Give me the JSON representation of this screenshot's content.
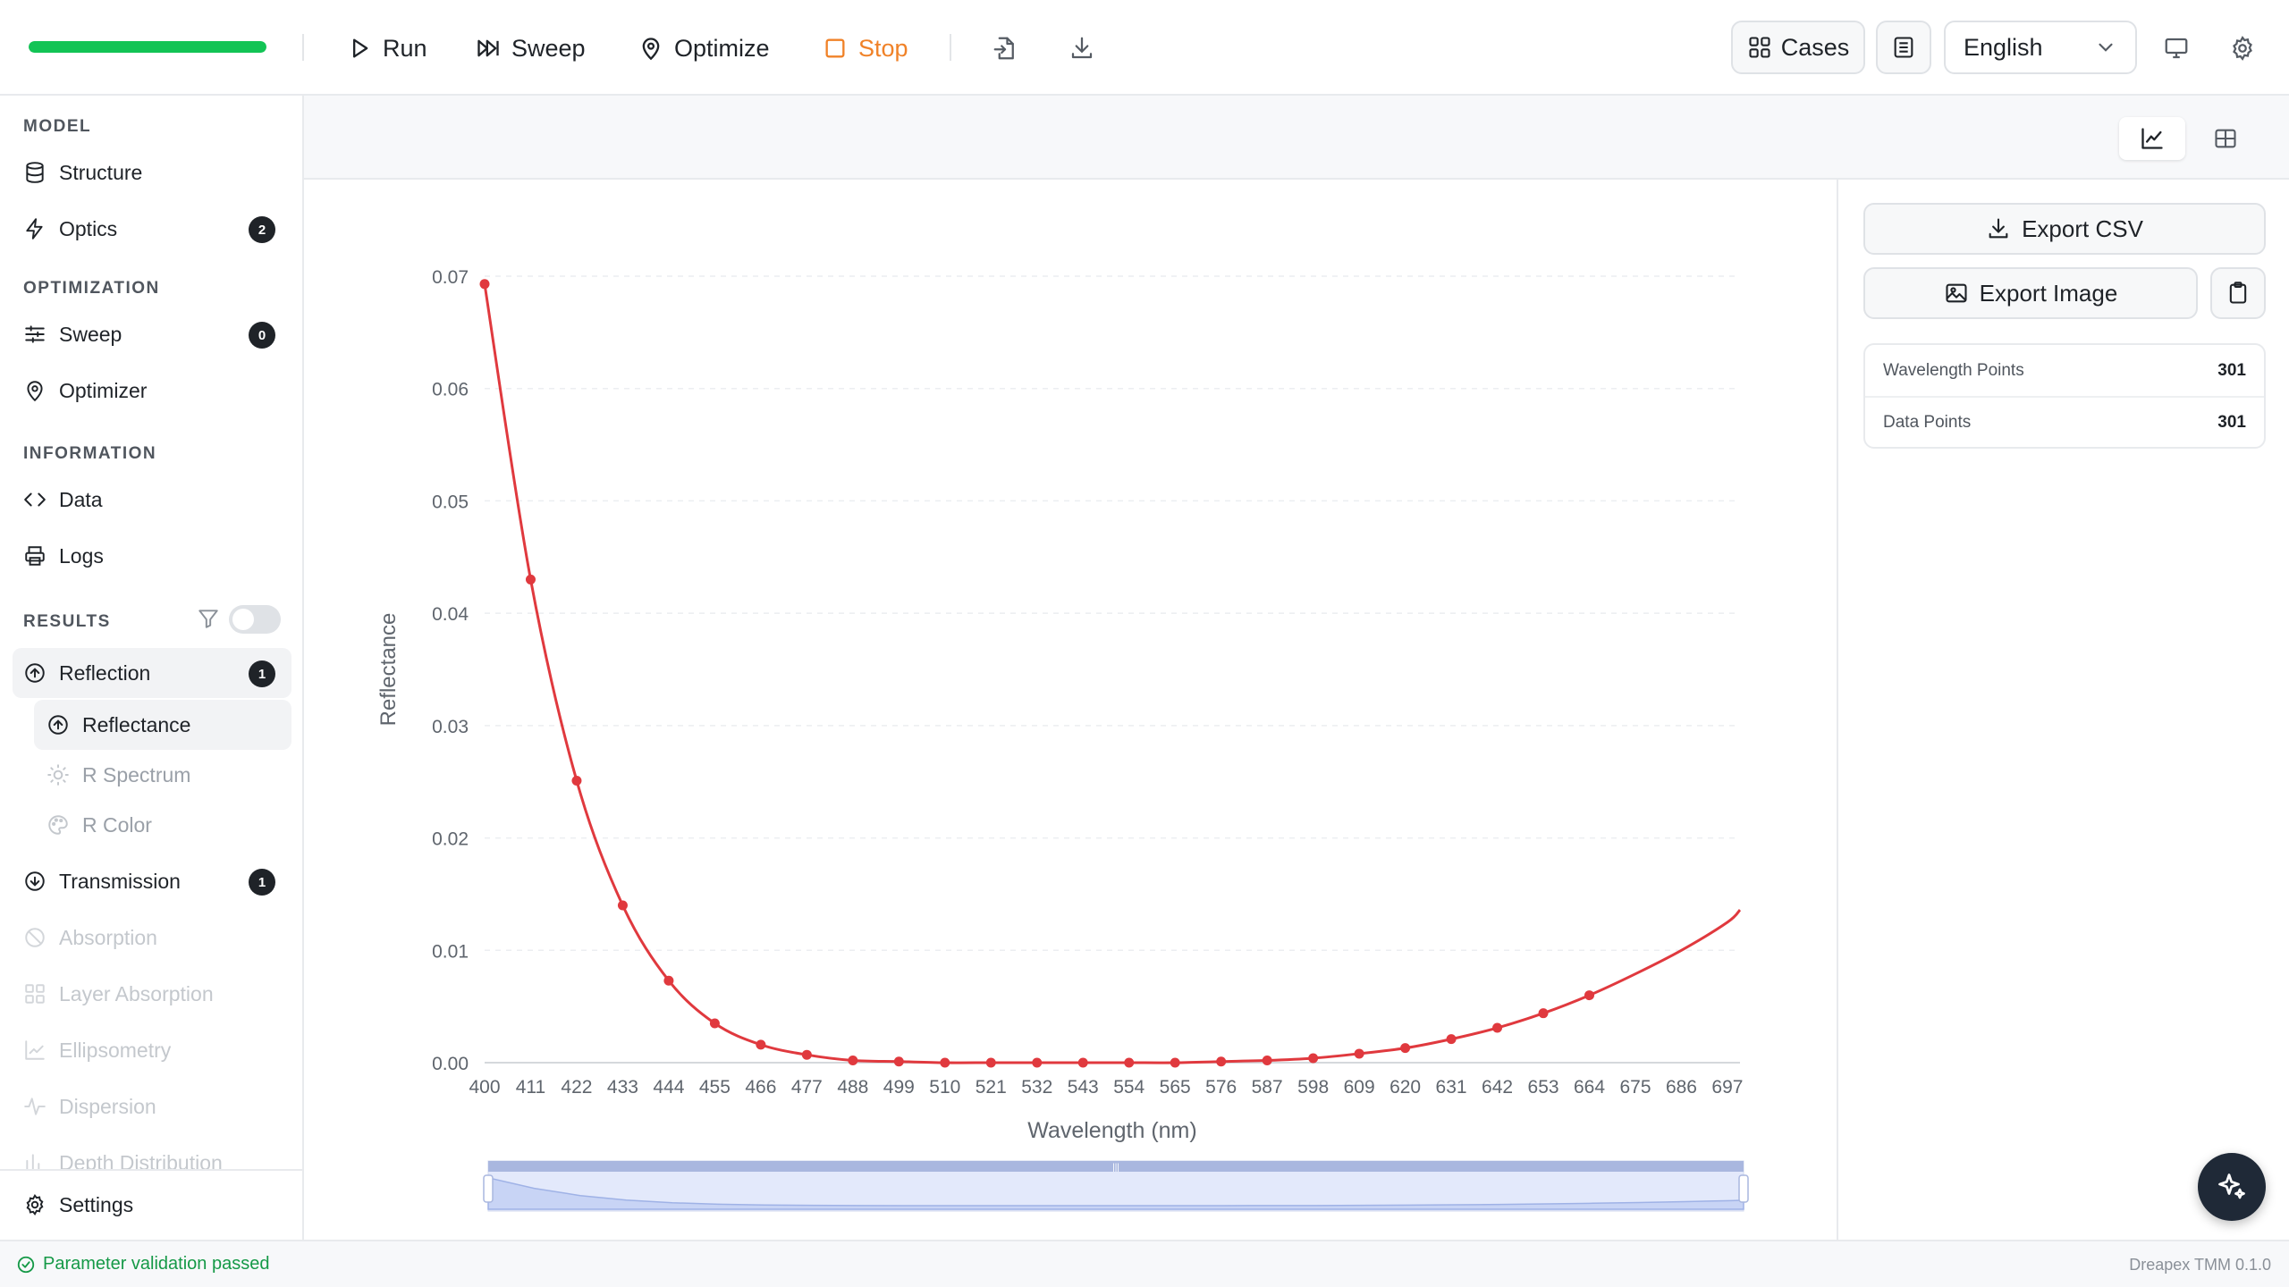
{
  "toolbar": {
    "progress_percent": 100,
    "run_label": "Run",
    "sweep_label": "Sweep",
    "optimize_label": "Optimize",
    "stop_label": "Stop",
    "cases_label": "Cases",
    "language": "English",
    "accent_stop_color": "#f08228",
    "progress_color": "#12c455"
  },
  "sidebar": {
    "model_title": "MODEL",
    "structure": "Structure",
    "optics": "Optics",
    "optics_badge": "2",
    "optimization_title": "OPTIMIZATION",
    "sweep": "Sweep",
    "sweep_badge": "0",
    "optimizer": "Optimizer",
    "information_title": "INFORMATION",
    "data": "Data",
    "logs": "Logs",
    "results_title": "RESULTS",
    "reflection": "Reflection",
    "reflection_badge": "1",
    "reflectance": "Reflectance",
    "r_spectrum": "R Spectrum",
    "r_color": "R Color",
    "transmission": "Transmission",
    "transmission_badge": "1",
    "absorption": "Absorption",
    "layer_absorption": "Layer Absorption",
    "ellipsometry": "Ellipsometry",
    "dispersion": "Dispersion",
    "depth_distribution": "Depth Distribution",
    "settings": "Settings"
  },
  "right_panel": {
    "export_csv": "Export CSV",
    "export_image": "Export Image",
    "stats": [
      {
        "label": "Wavelength Points",
        "value": "301"
      },
      {
        "label": "Data Points",
        "value": "301"
      }
    ]
  },
  "status": {
    "message": "Parameter validation passed",
    "version": "Dreapex TMM 0.1.0"
  },
  "chart_data": {
    "type": "line",
    "xlabel": "Wavelength (nm)",
    "ylabel": "Reflectance",
    "xlim": [
      400,
      700
    ],
    "ylim": [
      0,
      0.07
    ],
    "yticks": [
      "0.00",
      "0.01",
      "0.02",
      "0.03",
      "0.04",
      "0.05",
      "0.06",
      "0.07"
    ],
    "xticks": [
      "400",
      "411",
      "422",
      "433",
      "444",
      "455",
      "466",
      "477",
      "488",
      "499",
      "510",
      "521",
      "532",
      "543",
      "554",
      "565",
      "576",
      "587",
      "598",
      "609",
      "620",
      "631",
      "642",
      "653",
      "664",
      "675",
      "686",
      "697"
    ],
    "grid": true,
    "line_color": "#e0393e",
    "series": [
      {
        "x": [
          400,
          411,
          422,
          433,
          444,
          455,
          466,
          477,
          488,
          499,
          510,
          521,
          532,
          543,
          554,
          565,
          576,
          587,
          598,
          609,
          620,
          631,
          642,
          653,
          664,
          675,
          686,
          697,
          700
        ],
        "y": [
          0.0693,
          0.043,
          0.0251,
          0.014,
          0.0073,
          0.0035,
          0.0016,
          0.0007,
          0.0002,
          0.0001,
          0.0,
          0.0,
          0.0,
          0.0,
          0.0,
          0.0,
          0.0001,
          0.0002,
          0.0004,
          0.0008,
          0.0013,
          0.0021,
          0.0031,
          0.0044,
          0.006,
          0.0079,
          0.01,
          0.0125,
          0.0136
        ],
        "markers": [
          true,
          true,
          true,
          true,
          true,
          true,
          true,
          true,
          true,
          true,
          true,
          true,
          true,
          true,
          true,
          true,
          true,
          true,
          true,
          true,
          true,
          true,
          true,
          true,
          true,
          false,
          false,
          false,
          false
        ]
      }
    ]
  }
}
